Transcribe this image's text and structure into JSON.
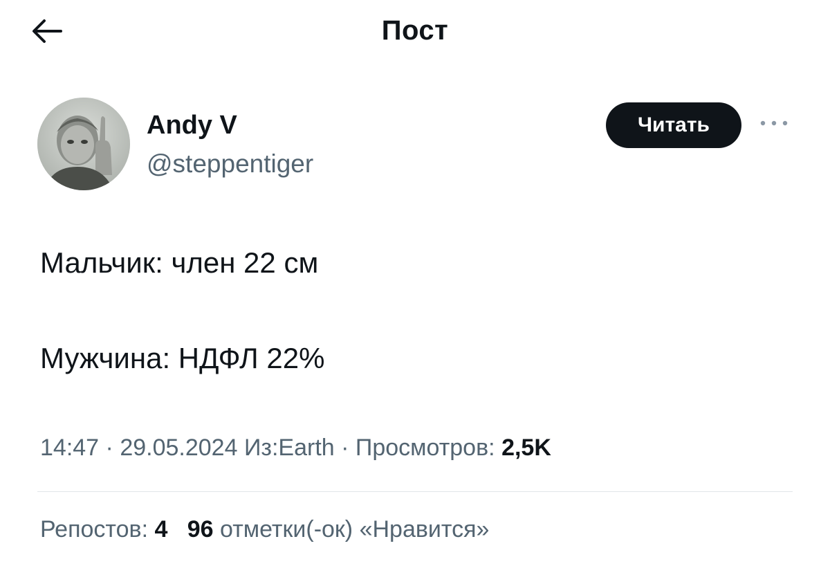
{
  "header": {
    "title": "Пост",
    "back_icon": "arrow-left-icon"
  },
  "author": {
    "display_name": "Andy V",
    "handle": "@steppentiger",
    "avatar_icon": "avatar-photo",
    "follow_label": "Читать",
    "more_icon": "more-horizontal-icon"
  },
  "post": {
    "lines": [
      "Мальчик: член 22 см",
      "Мужчина: НДФЛ 22%"
    ]
  },
  "meta": {
    "time": "14:47",
    "separator": " · ",
    "date": "29.05.2024",
    "source": "Из:Earth",
    "views_label": "Просмотров:",
    "views_value": "2,5K"
  },
  "stats": {
    "reposts_label": "Репостов:",
    "reposts_value": "4",
    "likes_value": "96",
    "likes_label": "отметки(-ок) «Нравится»"
  },
  "colors": {
    "text_primary": "#0f1419",
    "text_secondary": "#536471",
    "button_bg": "#0f1419",
    "divider": "#e1e5e8"
  }
}
